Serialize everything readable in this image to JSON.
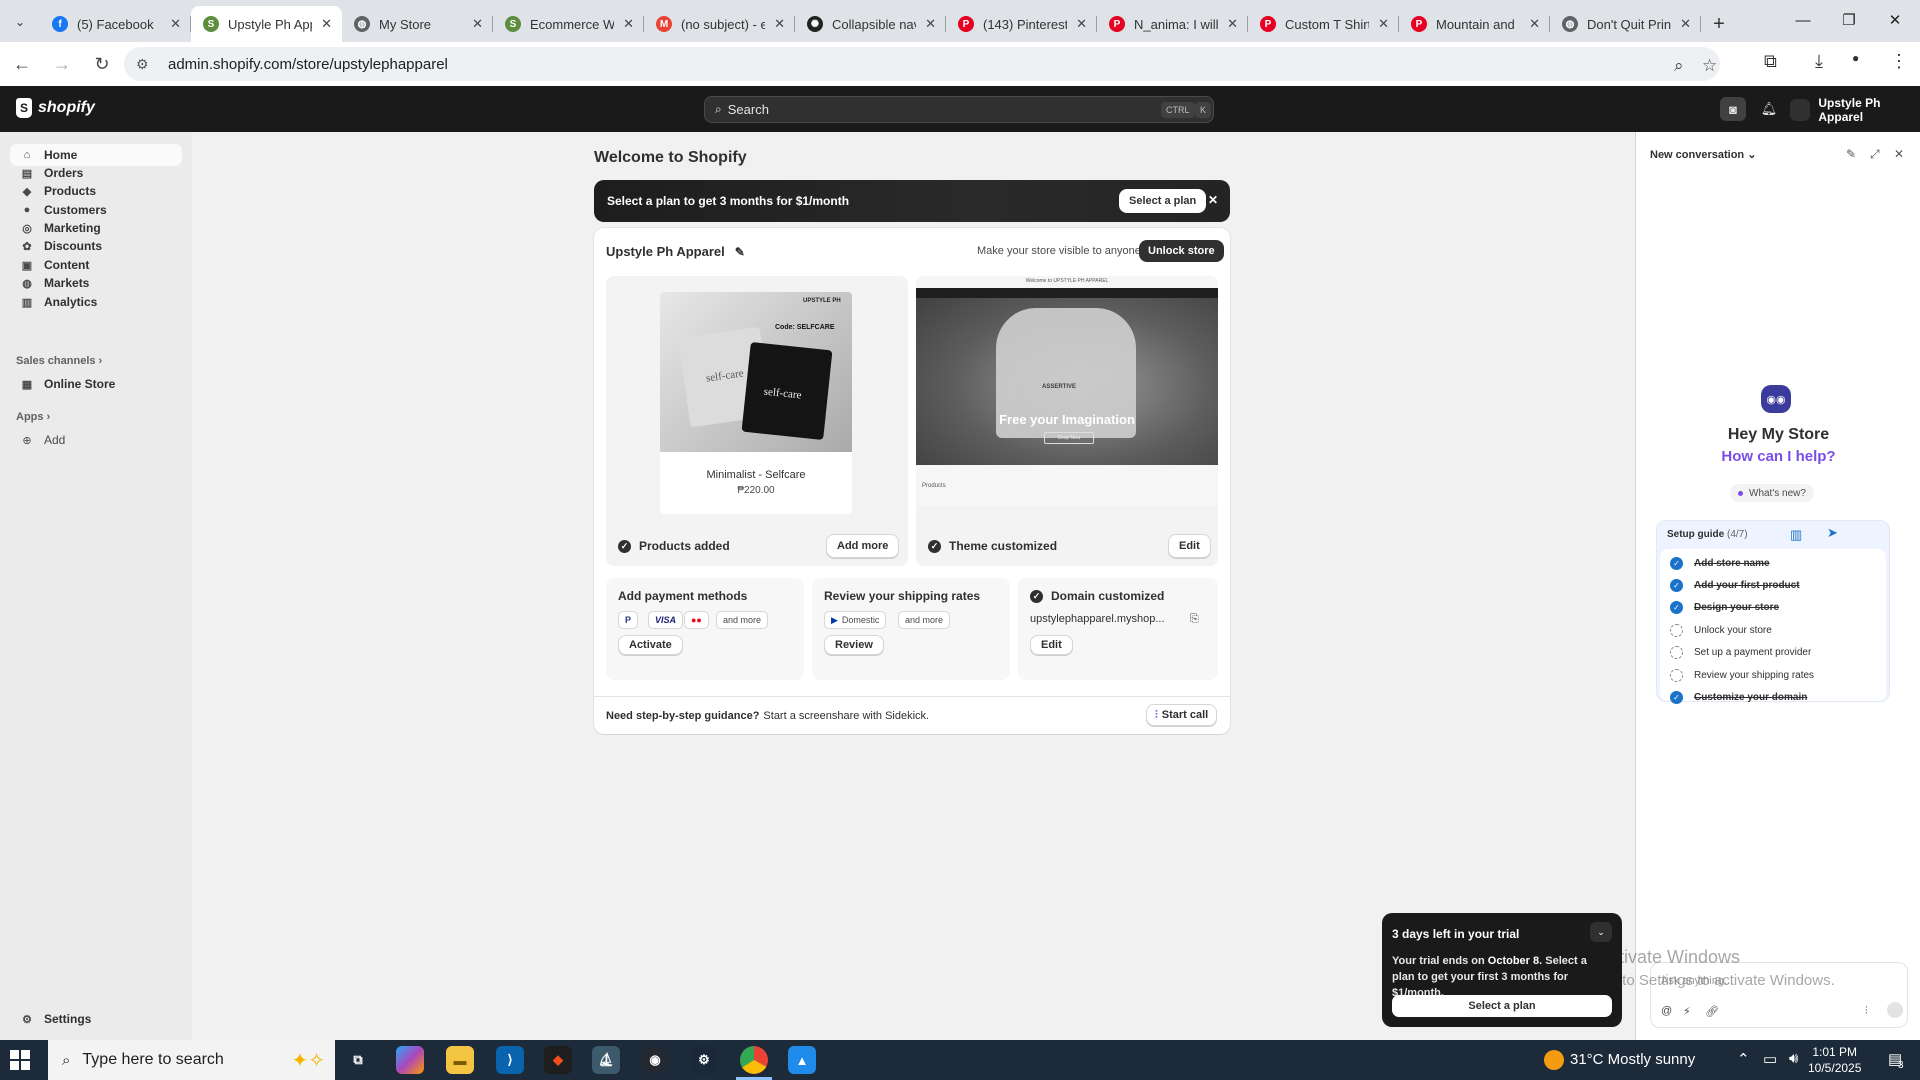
{
  "browser": {
    "tabs": [
      {
        "title": "(5) Facebook",
        "icon": "facebook-icon",
        "color": "#1877f2",
        "glyph": "f"
      },
      {
        "title": "Upstyle Ph App",
        "icon": "shopify-icon",
        "color": "#5e8e3e",
        "glyph": "S",
        "active": true
      },
      {
        "title": "My Store",
        "icon": "globe-icon",
        "color": "#5f6368",
        "glyph": "◍"
      },
      {
        "title": "Ecommerce W",
        "icon": "shopify-icon",
        "color": "#5e8e3e",
        "glyph": "S"
      },
      {
        "title": "(no subject) - e",
        "icon": "gmail-icon",
        "color": "#ea4335",
        "glyph": "M"
      },
      {
        "title": "Collapsible nav",
        "icon": "chatgpt-icon",
        "color": "#222222",
        "glyph": "✺"
      },
      {
        "title": "(143) Pinterest",
        "icon": "pinterest-icon",
        "color": "#e60023",
        "glyph": "P"
      },
      {
        "title": "N_anima: I will",
        "icon": "pinterest-icon",
        "color": "#e60023",
        "glyph": "P"
      },
      {
        "title": "Custom T Shirt",
        "icon": "pinterest-icon",
        "color": "#e60023",
        "glyph": "P"
      },
      {
        "title": "Mountain and",
        "icon": "pinterest-icon",
        "color": "#e60023",
        "glyph": "P"
      },
      {
        "title": "Don't Quit Prin",
        "icon": "globe-icon",
        "color": "#5f6368",
        "glyph": "◍"
      }
    ],
    "url": "admin.shopify.com/store/upstylephapparel"
  },
  "shopbar": {
    "logo": "shopify",
    "search_placeholder": "Search",
    "kbd_ctrl": "CTRL",
    "kbd_k": "K",
    "store_name": "Upstyle Ph Apparel"
  },
  "sidebar": {
    "items": [
      {
        "label": "Home",
        "icon": "home-icon",
        "glyph": "⌂",
        "active": true
      },
      {
        "label": "Orders",
        "icon": "inbox-icon",
        "glyph": "▤"
      },
      {
        "label": "Products",
        "icon": "tag-icon",
        "glyph": "◆"
      },
      {
        "label": "Customers",
        "icon": "person-icon",
        "glyph": "●"
      },
      {
        "label": "Marketing",
        "icon": "target-icon",
        "glyph": "◎"
      },
      {
        "label": "Discounts",
        "icon": "discount-icon",
        "glyph": "✿"
      },
      {
        "label": "Content",
        "icon": "content-icon",
        "glyph": "▣"
      },
      {
        "label": "Markets",
        "icon": "globe-icon",
        "glyph": "◍"
      },
      {
        "label": "Analytics",
        "icon": "chart-icon",
        "glyph": "▥"
      }
    ],
    "sales_channels": "Sales channels",
    "online_store": "Online Store",
    "apps": "Apps",
    "add": "Add",
    "settings": "Settings"
  },
  "main": {
    "title": "Welcome to Shopify",
    "banner_text": "Select a plan to get 3 months for $1/month",
    "banner_button": "Select a plan",
    "store_name": "Upstyle Ph Apparel",
    "visible_text": "Make your store visible to anyone",
    "unlock_button": "Unlock store",
    "product": {
      "brand": "UPSTYLE PH",
      "code": "Code: SELFCARE",
      "shirt_text": "self-care",
      "name": "Minimalist - Selfcare",
      "price": "₱220.00"
    },
    "products_added": "Products added",
    "add_more": "Add more",
    "theme": {
      "caption": "Welcome to UPSTYLE PH APPAREL",
      "shirt_text": "ASSERTIVE",
      "headline": "Free your Imagination",
      "shop_now": "Shop Now",
      "products_label": "Products"
    },
    "theme_customized": "Theme customized",
    "edit": "Edit",
    "payment_title": "Add payment methods",
    "payment_chips": [
      "P",
      "VISA",
      "●●",
      "and more"
    ],
    "activate": "Activate",
    "shipping_title": "Review your shipping rates",
    "shipping_chips": [
      "Domestic",
      "and more"
    ],
    "review": "Review",
    "domain_title": "Domain customized",
    "domain_value": "upstylephapparel.myshop...",
    "domain_edit": "Edit",
    "guidance_bold": "Need step-by-step guidance?",
    "guidance_text": "Start a screenshare with Sidekick.",
    "start_call": "Start call"
  },
  "sidekick": {
    "title": "New conversation",
    "hey": "Hey My Store",
    "help": "How can I help?",
    "whats_new": "What's new?",
    "guide_title": "Setup guide",
    "guide_progress": "(4/7)",
    "steps": [
      {
        "label": "Add store name",
        "done": true
      },
      {
        "label": "Add your first product",
        "done": true
      },
      {
        "label": "Design your store",
        "done": true
      },
      {
        "label": "Unlock your store",
        "done": false
      },
      {
        "label": "Set up a payment provider",
        "done": false
      },
      {
        "label": "Review your shipping rates",
        "done": false
      },
      {
        "label": "Customize your domain",
        "done": true
      }
    ],
    "input_placeholder": "Ask anything..."
  },
  "watermark": {
    "line1": "Activate Windows",
    "line2": "Go to Settings to activate Windows."
  },
  "trial": {
    "title": "3 days left in your trial",
    "body_pre": "Your trial ends on ",
    "body_date": "October 8",
    "body_post": ". Select a plan to get your first 3 months for $1/month.",
    "button": "Select a plan"
  },
  "taskbar": {
    "search": "Type here to search",
    "weather": "31°C  Mostly sunny",
    "time": "1:01 PM",
    "date": "10/5/2025",
    "notifications": "3"
  }
}
